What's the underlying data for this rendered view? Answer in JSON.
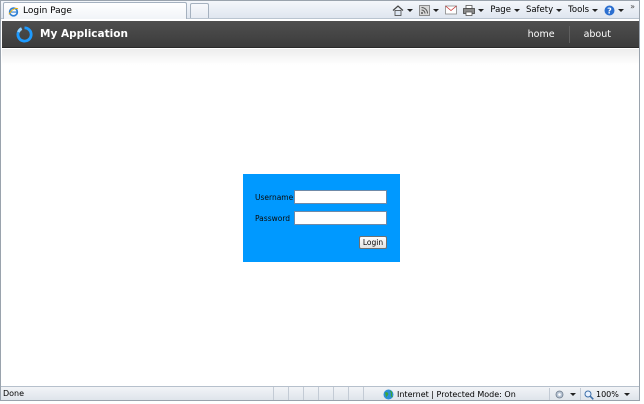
{
  "browser": {
    "tab_title": "Login Page",
    "commands": {
      "page_label": "Page",
      "safety_label": "Safety",
      "tools_label": "Tools",
      "overflow_label": "»"
    }
  },
  "app": {
    "title": "My Application",
    "nav": [
      {
        "label": "home"
      },
      {
        "label": "about"
      }
    ]
  },
  "login": {
    "username_label": "Username",
    "password_label": "Password",
    "username_value": "",
    "password_value": "",
    "button_label": "Login",
    "box_color": "#0099ff"
  },
  "status": {
    "left_text": "Done",
    "zone_text": "Internet | Protected Mode: On",
    "zoom_text": "100%"
  },
  "colors": {
    "header_bg": "#444444",
    "accent": "#0099ff"
  }
}
